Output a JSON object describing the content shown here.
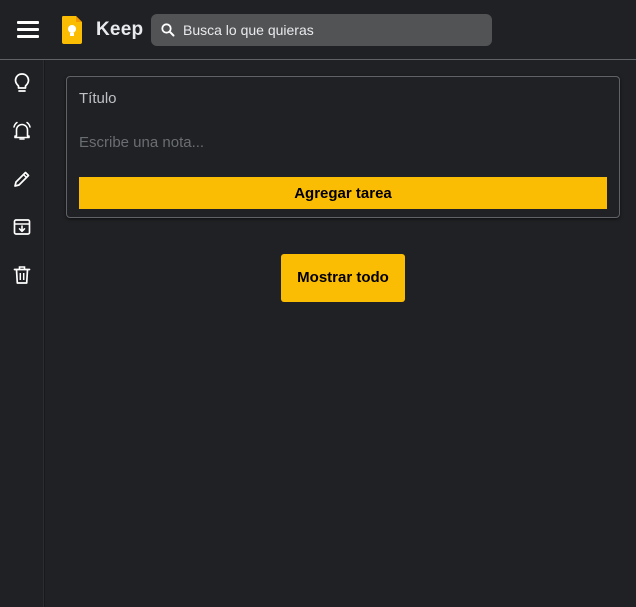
{
  "header": {
    "brand": "Keep",
    "search": {
      "placeholder": "Busca lo que quieras",
      "value": ""
    }
  },
  "sidebar": {
    "items": [
      {
        "icon": "lightbulb-icon"
      },
      {
        "icon": "bell-icon"
      },
      {
        "icon": "pencil-icon"
      },
      {
        "icon": "archive-icon"
      },
      {
        "icon": "trash-icon"
      }
    ]
  },
  "note_form": {
    "title_placeholder": "Título",
    "body_placeholder": "Escribe una nota...",
    "submit_label": "Agregar tarea"
  },
  "show_all_label": "Mostrar todo",
  "colors": {
    "background": "#202124",
    "accent": "#fbbc04",
    "search_bg": "#525355",
    "border": "#5f6368"
  }
}
